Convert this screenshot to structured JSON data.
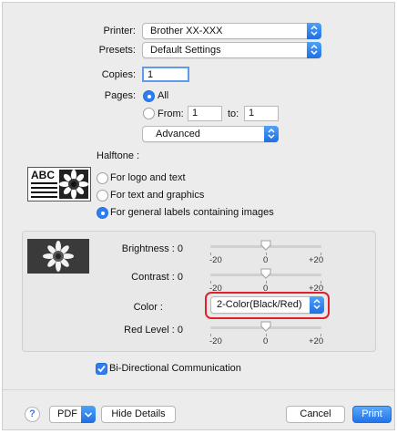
{
  "printer": {
    "label": "Printer:",
    "value": "Brother XX-XXX"
  },
  "presets": {
    "label": "Presets:",
    "value": "Default Settings"
  },
  "copies": {
    "label": "Copies:",
    "value": "1"
  },
  "pages": {
    "label": "Pages:",
    "all_label": "All",
    "from_label": "From:",
    "from_value": "1",
    "to_label": "to:",
    "to_value": "1",
    "selected": "All"
  },
  "panel_menu": {
    "value": "Advanced"
  },
  "halftone": {
    "label": "Halftone :",
    "preview_text": "ABC",
    "options": [
      "For logo and text",
      "For text and graphics",
      "For general labels containing images"
    ],
    "selected": "For general labels containing images"
  },
  "brightness": {
    "label": "Brightness : 0",
    "value": 0,
    "min_label": "-20",
    "mid_label": "0",
    "max_label": "+20",
    "min": -20,
    "max": 20
  },
  "contrast": {
    "label": "Contrast : 0",
    "value": 0,
    "min_label": "-20",
    "mid_label": "0",
    "max_label": "+20",
    "min": -20,
    "max": 20
  },
  "color": {
    "label": "Color :",
    "value": "2-Color(Black/Red)",
    "highlight_color": "#e0202a"
  },
  "red_level": {
    "label": "Red Level : 0",
    "value": 0,
    "min_label": "-20",
    "mid_label": "0",
    "max_label": "+20",
    "min": -20,
    "max": 20
  },
  "bidirectional": {
    "label": "Bi-Directional Communication",
    "checked": true
  },
  "footer": {
    "help_label": "?",
    "pdf_label": "PDF",
    "hide_details_label": "Hide Details",
    "cancel_label": "Cancel",
    "print_label": "Print"
  },
  "colors": {
    "accent": "#2f7ef0",
    "window_bg": "#ececec"
  }
}
